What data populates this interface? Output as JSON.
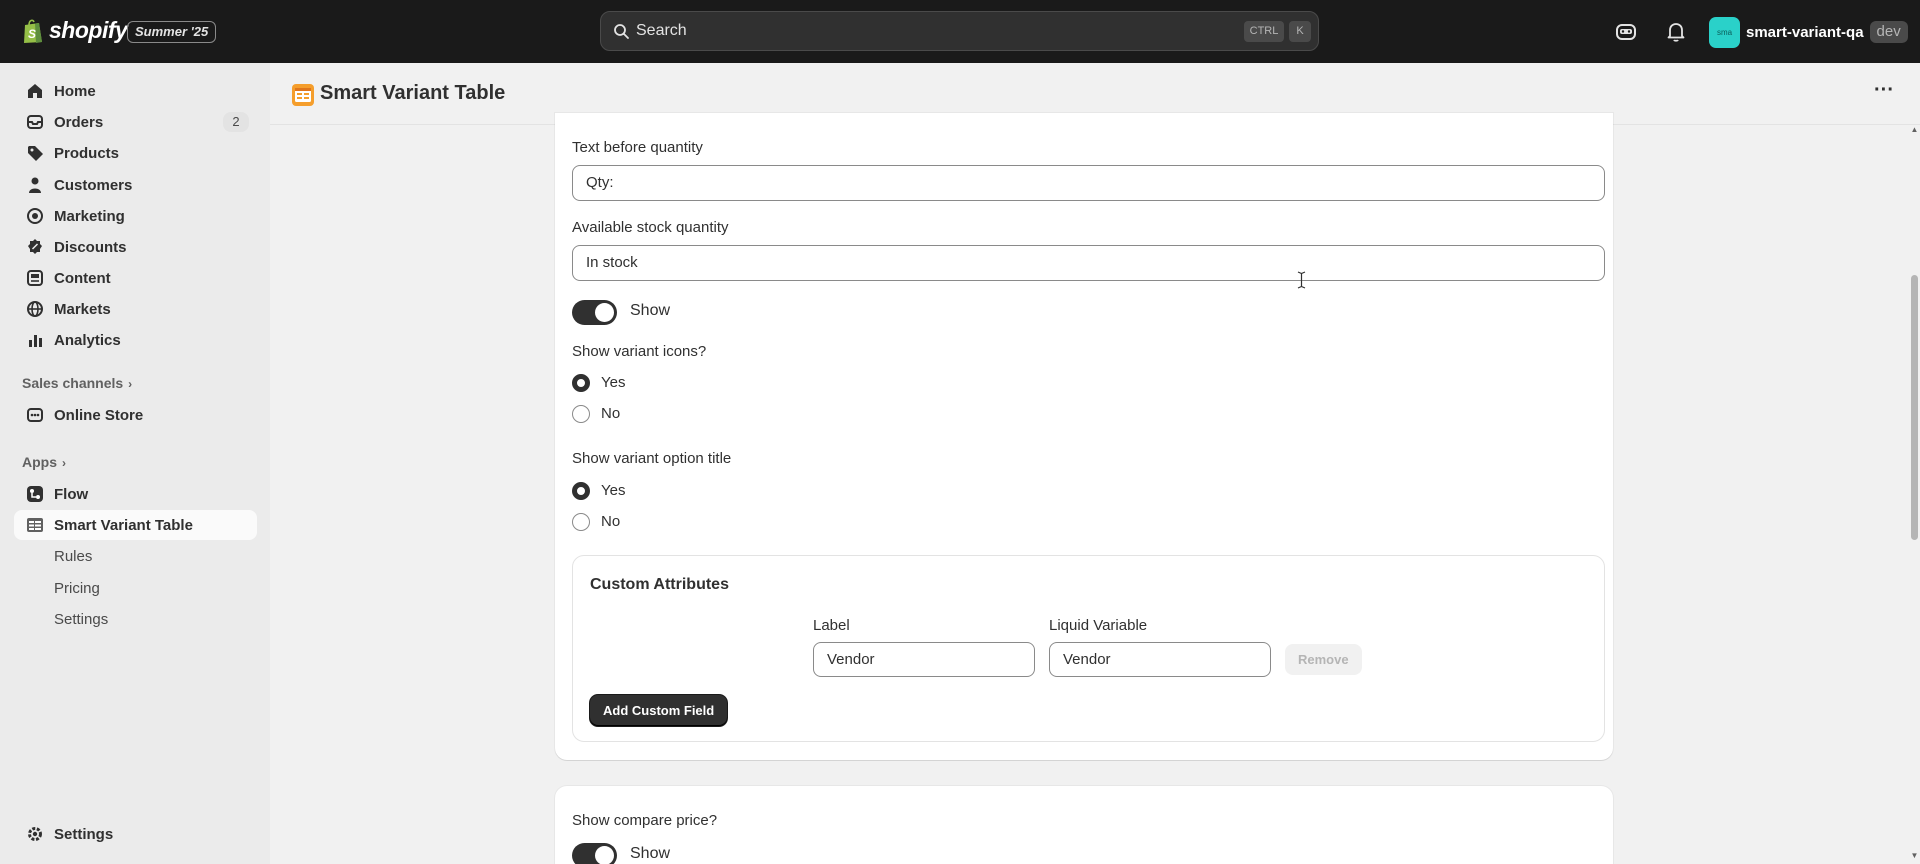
{
  "topbar": {
    "brand": "shopify",
    "edition": "Summer '25",
    "search_placeholder": "Search",
    "shortcut_ctrl": "CTRL",
    "shortcut_key": "K",
    "store_avatar": "sma",
    "store_name": "smart-variant-qa",
    "store_tag": "dev"
  },
  "sidebar": {
    "items": [
      {
        "label": "Home",
        "icon": "home-icon"
      },
      {
        "label": "Orders",
        "icon": "orders-icon",
        "badge": "2"
      },
      {
        "label": "Products",
        "icon": "tag-icon"
      },
      {
        "label": "Customers",
        "icon": "person-icon"
      },
      {
        "label": "Marketing",
        "icon": "target-icon"
      },
      {
        "label": "Discounts",
        "icon": "discount-icon"
      },
      {
        "label": "Content",
        "icon": "content-icon"
      },
      {
        "label": "Markets",
        "icon": "globe-icon"
      },
      {
        "label": "Analytics",
        "icon": "chart-icon"
      }
    ],
    "sales_channels_label": "Sales channels",
    "online_store": "Online Store",
    "apps_label": "Apps",
    "apps": [
      {
        "label": "Flow"
      },
      {
        "label": "Smart Variant Table"
      }
    ],
    "app_subitems": [
      "Rules",
      "Pricing",
      "Settings"
    ],
    "settings": "Settings"
  },
  "page": {
    "title": "Smart Variant Table",
    "more_label": "···"
  },
  "form": {
    "text_before_quantity_label": "Text before quantity",
    "text_before_quantity_value": "Qty:",
    "available_stock_label": "Available stock quantity",
    "available_stock_value": "In stock",
    "show_stock_toggle_label": "Show",
    "show_variant_icons_label": "Show variant icons?",
    "variant_icons_yes": "Yes",
    "variant_icons_no": "No",
    "show_option_title_label": "Show variant option title",
    "option_title_yes": "Yes",
    "option_title_no": "No",
    "custom_attributes": {
      "title": "Custom Attributes",
      "label_header": "Label",
      "variable_header": "Liquid Variable",
      "label_value": "Vendor",
      "variable_value": "Vendor",
      "remove_label": "Remove",
      "add_label": "Add Custom Field"
    },
    "show_compare_price_label": "Show compare price?",
    "compare_price_toggle_label": "Show"
  },
  "colors": {
    "topbar_bg": "#1a1a1a",
    "sidebar_bg": "#ebebeb",
    "primary_button": "#303030",
    "avatar": "#2ad1c9"
  }
}
